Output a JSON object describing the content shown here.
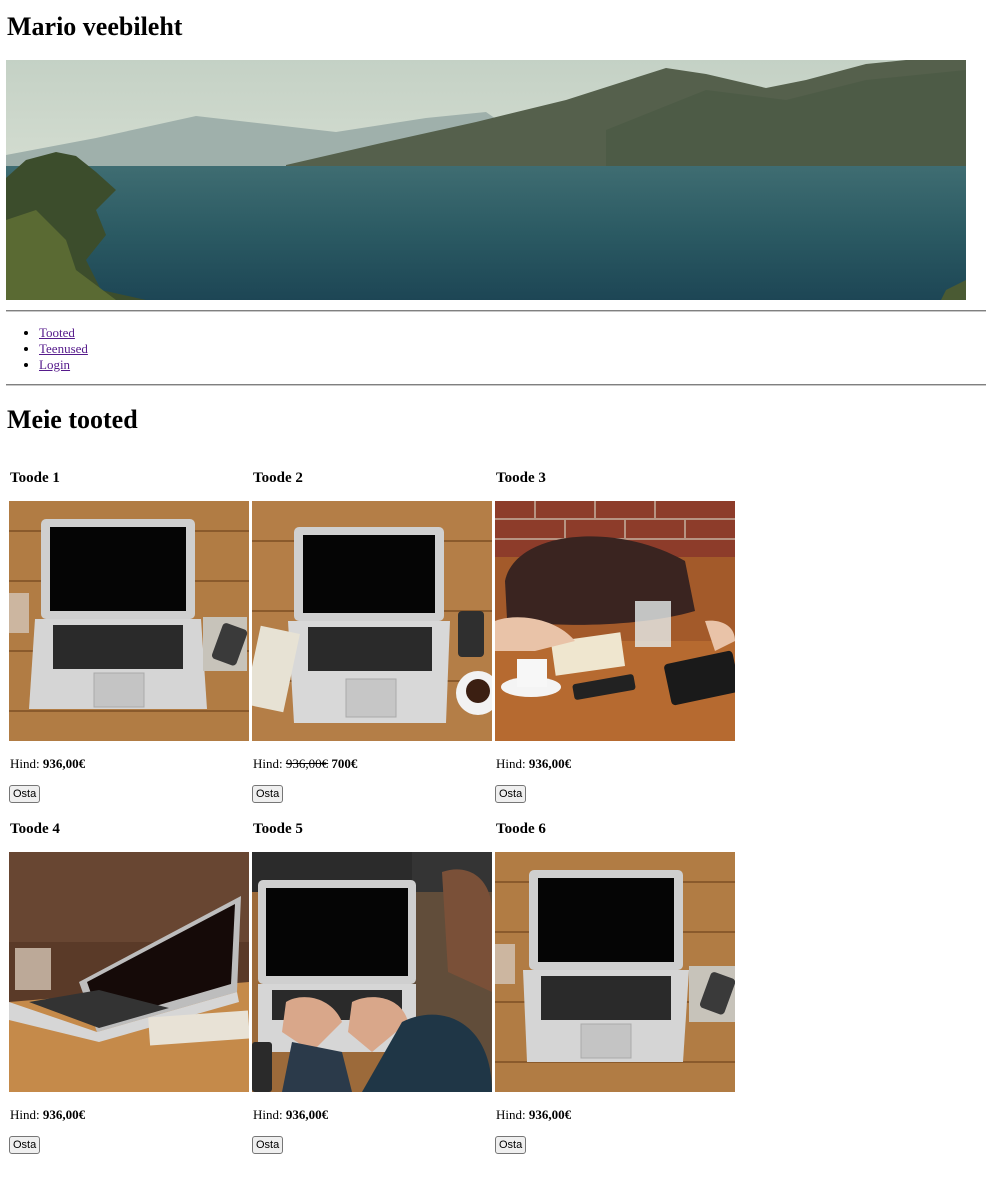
{
  "site": {
    "title": "Mario veebileht"
  },
  "nav": {
    "items": [
      "Tooted",
      "Teenused",
      "Login"
    ]
  },
  "section": {
    "title": "Meie tooted"
  },
  "labels": {
    "price_prefix": "Hind:",
    "buy": "Osta"
  },
  "products": [
    {
      "name": "Toode 1",
      "price": "936,00€",
      "old_price": "",
      "image": "laptop-on-wooden-table-photo"
    },
    {
      "name": "Toode 2",
      "price": "700€",
      "old_price": "936,00€",
      "image": "laptop-with-phone-and-coffee-photo"
    },
    {
      "name": "Toode 3",
      "price": "936,00€",
      "old_price": "",
      "image": "desk-with-bag-tablet-and-coffee-photo"
    },
    {
      "name": "Toode 4",
      "price": "936,00€",
      "old_price": "",
      "image": "laptop-side-view-blurred-photo"
    },
    {
      "name": "Toode 5",
      "price": "936,00€",
      "old_price": "",
      "image": "person-typing-on-laptop-photo"
    },
    {
      "name": "Toode 6",
      "price": "936,00€",
      "old_price": "",
      "image": "laptop-on-wooden-table-photo"
    }
  ],
  "hero": {
    "image": "mountain-lake-landscape-photo"
  }
}
